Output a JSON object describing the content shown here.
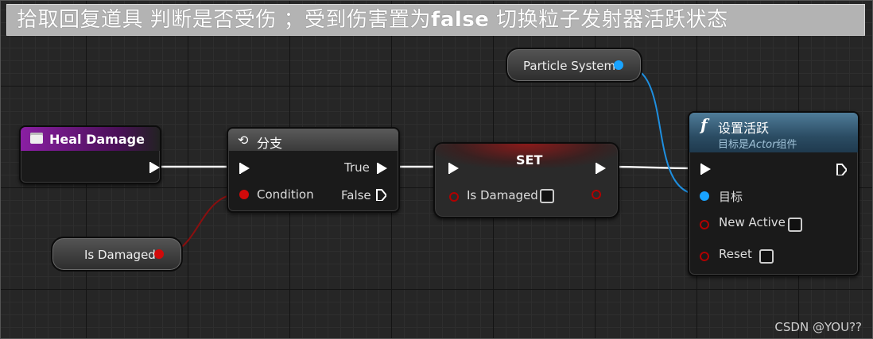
{
  "banner": {
    "pre": "拾取回复道具 判断是否受伤 ；受到伤害置为",
    "bold": "false",
    "post": " 切换粒子发射器活跃状态"
  },
  "nodes": {
    "heal_damage": {
      "title": "Heal Damage",
      "color": "#8a1fa3"
    },
    "branch": {
      "title": "分支",
      "true_label": "True",
      "false_label": "False",
      "condition_label": "Condition"
    },
    "set": {
      "title": "SET",
      "var_label": "Is Damaged"
    },
    "set_active": {
      "title": "设置活跃",
      "subtitle_prefix": "目标是",
      "subtitle_em": "Actor",
      "subtitle_suffix": "组件",
      "target_label": "目标",
      "new_active_label": "New Active",
      "reset_label": "Reset"
    },
    "is_damaged_var": {
      "label": "Is Damaged"
    },
    "particle_var": {
      "label": "Particle System"
    }
  },
  "colors": {
    "bool_pin": "#d10a0a",
    "object_pin": "#19a3ff",
    "exec": "#ffffff",
    "event_header": "#8a1fa3",
    "function_header": "#3b6e8f"
  },
  "watermark": "CSDN @YOU??"
}
